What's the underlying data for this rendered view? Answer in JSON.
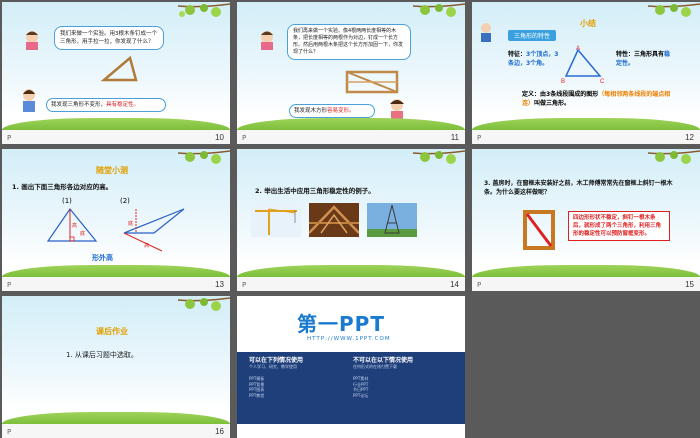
{
  "slides": [
    {
      "id": "slide-10",
      "number": "10",
      "bubble_text": "我们来做一个实验。用3根木条钉成一个三角形，用手拉一拉，你发现了什么？",
      "answer_text": "我发现三角形不变形，",
      "answer_highlight": "具有稳定性。"
    },
    {
      "id": "slide-11",
      "number": "11",
      "bubble_text": "我们再来做一个实验。像4根两两长度相等的木条，把长度相等的两根作为对边，钉成一个长方形。然后用两根木条把这个长方形加固一下，你发现了什么？",
      "answer_text": "我发现木方形",
      "answer_highlight": "容易变形。"
    },
    {
      "id": "slide-12",
      "number": "12",
      "title": "小结",
      "tag": "三角形的特性",
      "feature1_label": "特征：",
      "feature1_value": "3个顶点，3条边，3个角。",
      "feature2_label": "特性：",
      "feature2_value_a": "三角形具有",
      "feature2_value_b": "稳定性。",
      "vertex_a": "A",
      "vertex_b": "B",
      "vertex_c": "C",
      "definition_label": "定义：",
      "definition_text": "由3条线段围成的图形",
      "definition_note": "（每相邻两条线段的端点相连）",
      "definition_end": "叫做三角形。"
    },
    {
      "id": "slide-13",
      "number": "13",
      "title": "随堂小测",
      "question": "1. 画出下面三角形各边对应的高。",
      "label1": "(1)",
      "label2": "(2)",
      "side": "底",
      "height": "高",
      "outside": "形外高"
    },
    {
      "id": "slide-14",
      "number": "14",
      "question": "2. 举出生活中应用三角形稳定性的例子。"
    },
    {
      "id": "slide-15",
      "number": "15",
      "question": "3. 盖房时，在窗框未安装好之前，木工师傅常常先在窗框上斜钉一根木条。为什么要这样做呢？",
      "answer": "四边形形状不稳定，斜钉一根木条后，就形成了两个三角形，利用三角形的稳定性可以预防窗框变形。"
    },
    {
      "id": "slide-16",
      "number": "16",
      "title": "课后作业",
      "item": "1. 从课后习题中选取。"
    },
    {
      "id": "slide-17",
      "number": "17",
      "logo": "第一PPT",
      "url": "HTTP://WWW.1PPT.COM",
      "col1_title": "可以在下列情况使用",
      "col1_sub": "个人学习、研究、教学使用",
      "col2_title": "不可以在以下情况使用",
      "col2_sub": "任何形式的在线付费下载",
      "links": [
        "PPT模板",
        "PPT背景",
        "PPT图表",
        "PPT教程",
        "PPT素材",
        "行业PPT",
        "节日PPT",
        "PPT论坛"
      ]
    }
  ]
}
